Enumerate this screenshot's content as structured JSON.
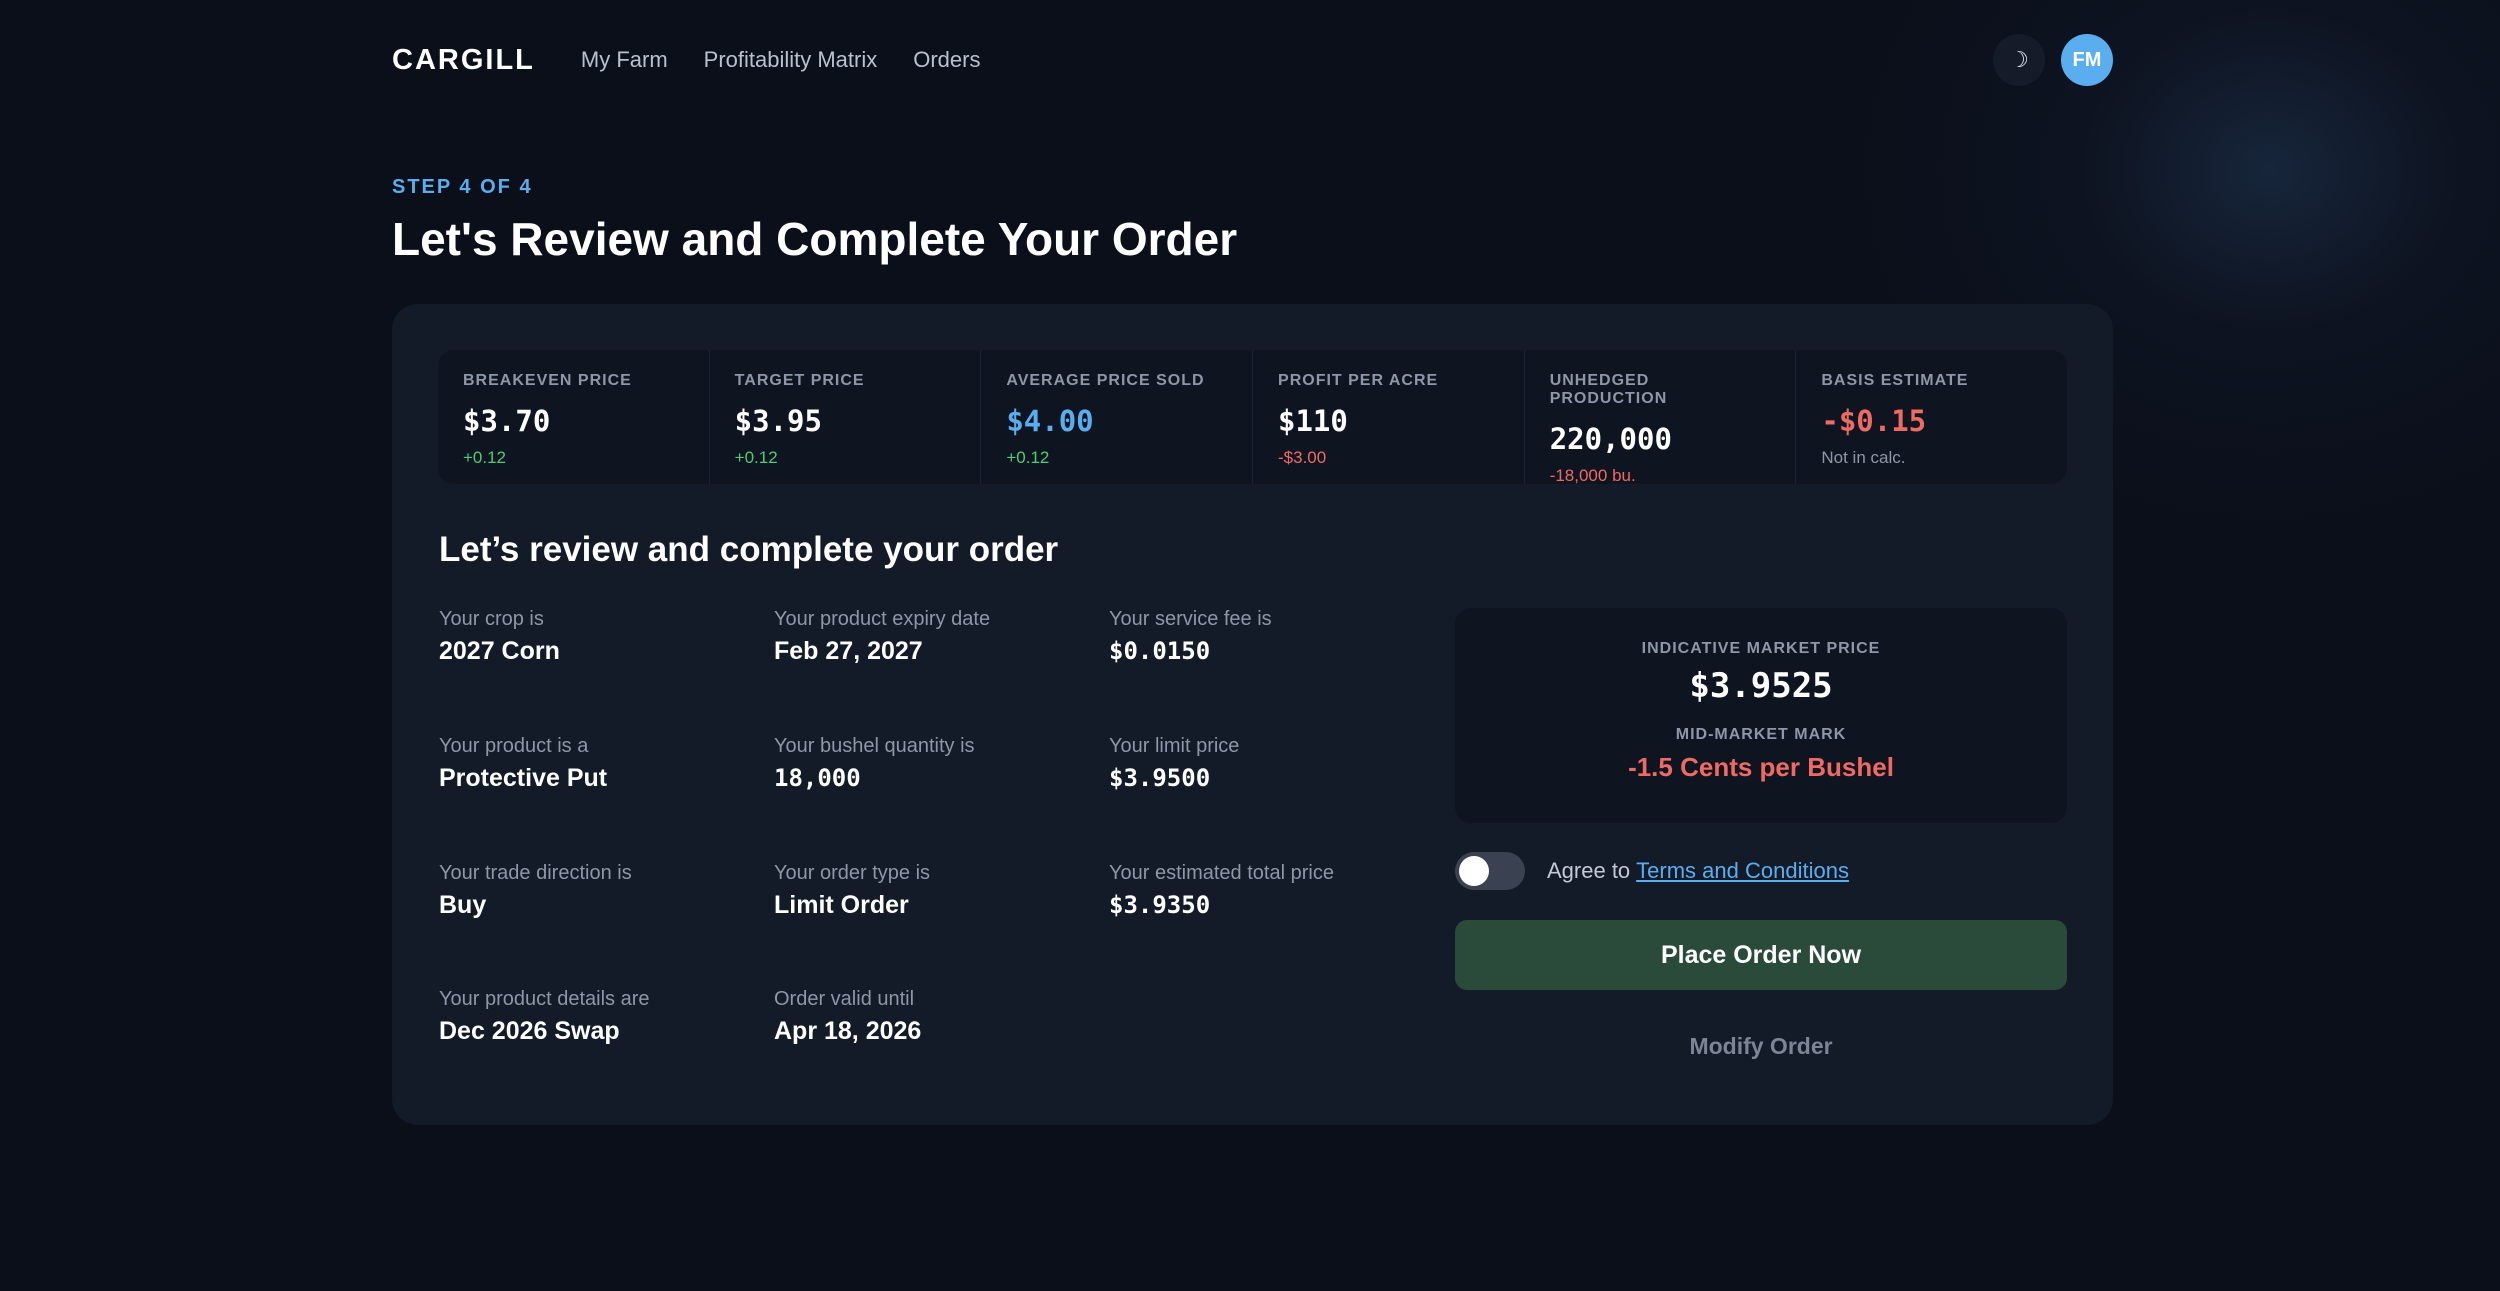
{
  "header": {
    "logo": "CARGILL",
    "nav": [
      "My Farm",
      "Profitability Matrix",
      "Orders"
    ],
    "theme_icon": "☽",
    "avatar": "FM"
  },
  "page": {
    "step": "STEP 4 OF 4",
    "title": "Let's Review and Complete Your Order"
  },
  "stats": [
    {
      "label": "BREAKEVEN PRICE",
      "value": "$3.70",
      "delta": "+0.12"
    },
    {
      "label": "TARGET PRICE",
      "value": "$3.95",
      "delta": "+0.12"
    },
    {
      "label": "AVERAGE PRICE SOLD",
      "value": "$4.00",
      "delta": "+0.12"
    },
    {
      "label": "PROFIT PER ACRE",
      "value": "$110",
      "delta": "-$3.00"
    },
    {
      "label": "UNHEDGED PRODUCTION",
      "value": "220,000",
      "delta": "-18,000 bu."
    },
    {
      "label": "BASIS ESTIMATE",
      "value": "-$0.15",
      "delta": "Not in calc."
    }
  ],
  "review": {
    "title": "Let’s review and complete your order",
    "items": [
      {
        "label": "Your crop is",
        "value": "2027 Corn"
      },
      {
        "label": "Your product expiry date",
        "value": "Feb 27, 2027"
      },
      {
        "label": "Your service fee is",
        "value": "$0.0150"
      },
      {
        "label": "Your product is a",
        "value": "Protective Put"
      },
      {
        "label": "Your bushel quantity is",
        "value": "18,000"
      },
      {
        "label": "Your limit price",
        "value": "$3.9500"
      },
      {
        "label": "Your trade direction is",
        "value": "Buy"
      },
      {
        "label": "Your order type is",
        "value": "Limit Order"
      },
      {
        "label": "Your estimated total price",
        "value": "$3.9350"
      },
      {
        "label": "Your product details are",
        "value": "Dec 2026 Swap"
      },
      {
        "label": "Order valid until",
        "value": "Apr 18, 2026"
      }
    ]
  },
  "market": {
    "label": "INDICATIVE MARKET PRICE",
    "price": "$3.9525",
    "mark_label": "MID-MARKET MARK",
    "mark_value": "-1.5 Cents per Bushel"
  },
  "agreement": {
    "text": "Agree to",
    "link": "Terms and Conditions",
    "checked": false
  },
  "actions": {
    "place_order": "Place Order Now",
    "modify_order": "Modify Order"
  },
  "colors": {
    "background": "#0b0f1a",
    "card": "#131a28",
    "accent_blue": "#5aaef0",
    "positive": "#4ccd75",
    "negative": "#ef6a62",
    "place_button": "#2a4b3a"
  }
}
